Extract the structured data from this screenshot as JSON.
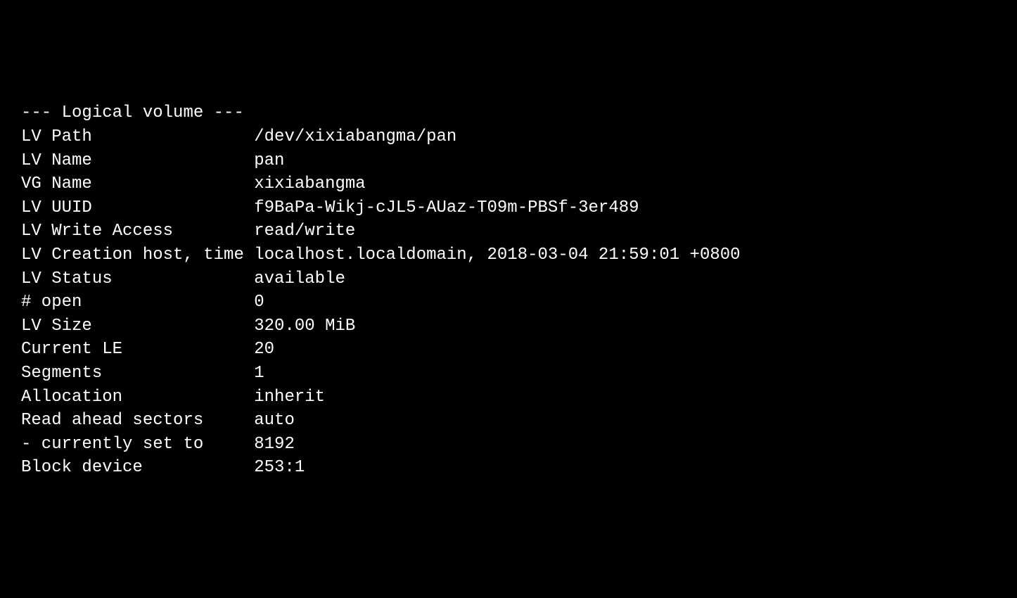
{
  "header": "--- Logical volume ---",
  "rows": [
    {
      "label": "LV Path",
      "value": "/dev/xixiabangma/pan"
    },
    {
      "label": "LV Name",
      "value": "pan"
    },
    {
      "label": "VG Name",
      "value": "xixiabangma"
    },
    {
      "label": "LV UUID",
      "value": "f9BaPa-Wikj-cJL5-AUaz-T09m-PBSf-3er489"
    },
    {
      "label": "LV Write Access",
      "value": "read/write"
    },
    {
      "label": "LV Creation host, time",
      "value": "localhost.localdomain, 2018-03-04 21:59:01 +0800"
    },
    {
      "label": "LV Status",
      "value": "available"
    },
    {
      "label": "# open",
      "value": "0"
    },
    {
      "label": "LV Size",
      "value": "320.00 MiB"
    },
    {
      "label": "Current LE",
      "value": "20"
    },
    {
      "label": "Segments",
      "value": "1"
    },
    {
      "label": "Allocation",
      "value": "inherit"
    },
    {
      "label": "Read ahead sectors",
      "value": "auto"
    },
    {
      "label": "- currently set to",
      "value": "8192"
    },
    {
      "label": "Block device",
      "value": "253:1"
    }
  ]
}
